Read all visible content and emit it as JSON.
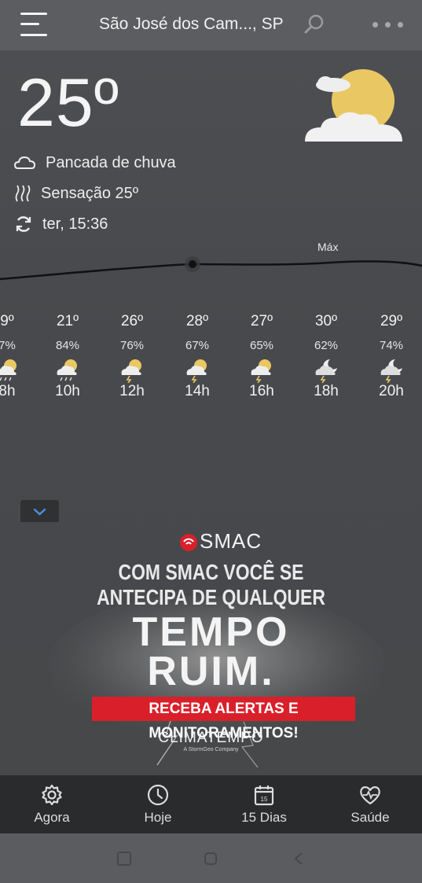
{
  "header": {
    "city": "São José dos Cam..., SP",
    "menu_icon": "hamburger-menu-icon",
    "search_icon": "search-icon",
    "more_icon": "more-dots-icon"
  },
  "current": {
    "temperature": "25º",
    "condition": "Pancada de chuva",
    "feels_like": "Sensação 25º",
    "updated": "ter, 15:36",
    "icon": "partly-cloudy-sun-icon"
  },
  "chart": {
    "max_label": "Máx"
  },
  "hourly": [
    {
      "temp": "9º",
      "precip": "7%",
      "hour": "8h",
      "icon": "sun-cloud-rain-icon"
    },
    {
      "temp": "21º",
      "precip": "84%",
      "hour": "10h",
      "icon": "sun-cloud-rain-icon"
    },
    {
      "temp": "26º",
      "precip": "76%",
      "hour": "12h",
      "icon": "sun-cloud-storm-icon"
    },
    {
      "temp": "28º",
      "precip": "67%",
      "hour": "14h",
      "icon": "sun-cloud-storm-icon"
    },
    {
      "temp": "27º",
      "precip": "65%",
      "hour": "16h",
      "icon": "sun-cloud-storm-icon"
    },
    {
      "temp": "30º",
      "precip": "62%",
      "hour": "18h",
      "icon": "moon-cloud-storm-icon"
    },
    {
      "temp": "29º",
      "precip": "74%",
      "hour": "20h",
      "icon": "moon-cloud-storm-icon"
    }
  ],
  "ad": {
    "brand": "SMAC",
    "line1": "COM SMAC VOCÊ SE",
    "line2": "ANTECIPA DE QUALQUER",
    "line3": "TEMPO",
    "line4": "RUIM.",
    "cta": "RECEBA ALERTAS E MONITORAMENTOS!",
    "logo": "CLIMATEMPO",
    "logo_sub": "A StormGeo Company"
  },
  "nav": {
    "items": [
      {
        "label": "Agora",
        "icon": "gear-icon"
      },
      {
        "label": "Hoje",
        "icon": "clock-icon"
      },
      {
        "label": "15 Dias",
        "icon": "calendar-icon",
        "badge": "15"
      },
      {
        "label": "Saúde",
        "icon": "heart-pulse-icon"
      }
    ]
  },
  "colors": {
    "background": "#47494b",
    "topbar": "#5b5d60",
    "nav": "#2a2b2d",
    "accent_red": "#d9202a",
    "sun": "#e9c864",
    "chevron_blue": "#4a90d9"
  }
}
